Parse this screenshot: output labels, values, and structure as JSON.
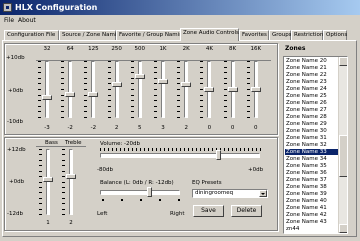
{
  "app": {
    "title": "HLX Configuration"
  },
  "menu": [
    "File",
    "About"
  ],
  "tabs": [
    "Configuration File",
    "Source / Zone Naming",
    "Favorite / Group Naming",
    "Zone Audio Controls",
    "Favorites",
    "Groups",
    "Restrictions",
    "Options"
  ],
  "active_tab": "Zone Audio Controls",
  "eq": {
    "bands": [
      "32",
      "64",
      "125",
      "250",
      "500",
      "1K",
      "2K",
      "4K",
      "8K",
      "16K"
    ],
    "values": [
      "-3",
      "-2",
      "-2",
      "2",
      "5",
      "3",
      "2",
      "0",
      "0",
      "0"
    ],
    "levels": [
      -3,
      -2,
      -2,
      2,
      5,
      3,
      2,
      0,
      0,
      0
    ],
    "scale": [
      "+10db",
      "+0db",
      "-10db"
    ]
  },
  "bass": {
    "label": "Bass",
    "value": "1",
    "level": 1,
    "scale": [
      "+12db",
      "+0db",
      "-12db"
    ]
  },
  "treble": {
    "label": "Treble",
    "value": "2",
    "level": 2
  },
  "volume": {
    "label": "Volume: -20db",
    "min_label": "-80db",
    "max_label": "+0db",
    "fraction": 0.75
  },
  "balance": {
    "label": "Balance (L: 0db / R: -12db)",
    "left_label": "Left",
    "right_label": "Right",
    "fraction": 0.62
  },
  "eq_presets": {
    "label": "EQ Presets",
    "selected": "diningroomeq"
  },
  "buttons": {
    "save": "Save",
    "delete": "Delete"
  },
  "zones": {
    "label": "Zones",
    "items": [
      "Zone Name 20",
      "Zone Name 21",
      "Zone Name 22",
      "Zone Name 23",
      "Zone Name 24",
      "Zone Name 25",
      "Zone Name 26",
      "Zone Name 27",
      "Zone Name 28",
      "Zone Name 29",
      "Zone Name 30",
      "Zone Name 31",
      "Zone Name 32",
      "Zone Name 33",
      "Zone Name 34",
      "Zone Name 35",
      "Zone Name 36",
      "Zone Name 37",
      "Zone Name 38",
      "Zone Name 39",
      "Zone Name 40",
      "Zone Name 41",
      "Zone Name 42",
      "Zone Name 43",
      "zn44"
    ],
    "selected": "Zone Name 33"
  }
}
